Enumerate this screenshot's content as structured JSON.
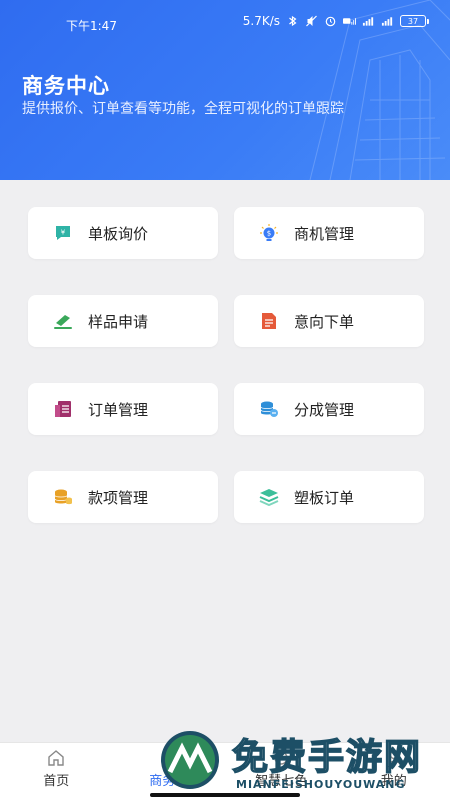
{
  "status_bar": {
    "time": "下午1:47",
    "network_speed": "5.7K/s",
    "battery": "37"
  },
  "header": {
    "title": "商务中心",
    "subtitle": "提供报价、订单查看等功能，全程可视化的订单跟踪"
  },
  "menu": [
    {
      "label": "单板询价",
      "icon": "inquiry-icon",
      "color": "#2fb3a6"
    },
    {
      "label": "商机管理",
      "icon": "lightbulb-icon",
      "color": "#3a7cf6"
    },
    {
      "label": "样品申请",
      "icon": "sample-icon",
      "color": "#3aa85a"
    },
    {
      "label": "意向下单",
      "icon": "document-icon",
      "color": "#e55a3a"
    },
    {
      "label": "订单管理",
      "icon": "order-list-icon",
      "color": "#a0306a"
    },
    {
      "label": "分成管理",
      "icon": "coins-share-icon",
      "color": "#2f8fd8"
    },
    {
      "label": "款项管理",
      "icon": "coins-icon",
      "color": "#e8a126"
    },
    {
      "label": "塑板订单",
      "icon": "layers-icon",
      "color": "#3cbf9a"
    }
  ],
  "tabbar": [
    {
      "label": "首页",
      "icon": "home-icon"
    },
    {
      "label": "商务中",
      "icon": "business-icon"
    },
    {
      "label": "智慧七色",
      "icon": "smart-icon"
    },
    {
      "label": "我的",
      "icon": "profile-icon"
    }
  ],
  "watermark": {
    "title": "免费手游网",
    "subtitle": "MIANFEISHOUYOUWANG"
  }
}
